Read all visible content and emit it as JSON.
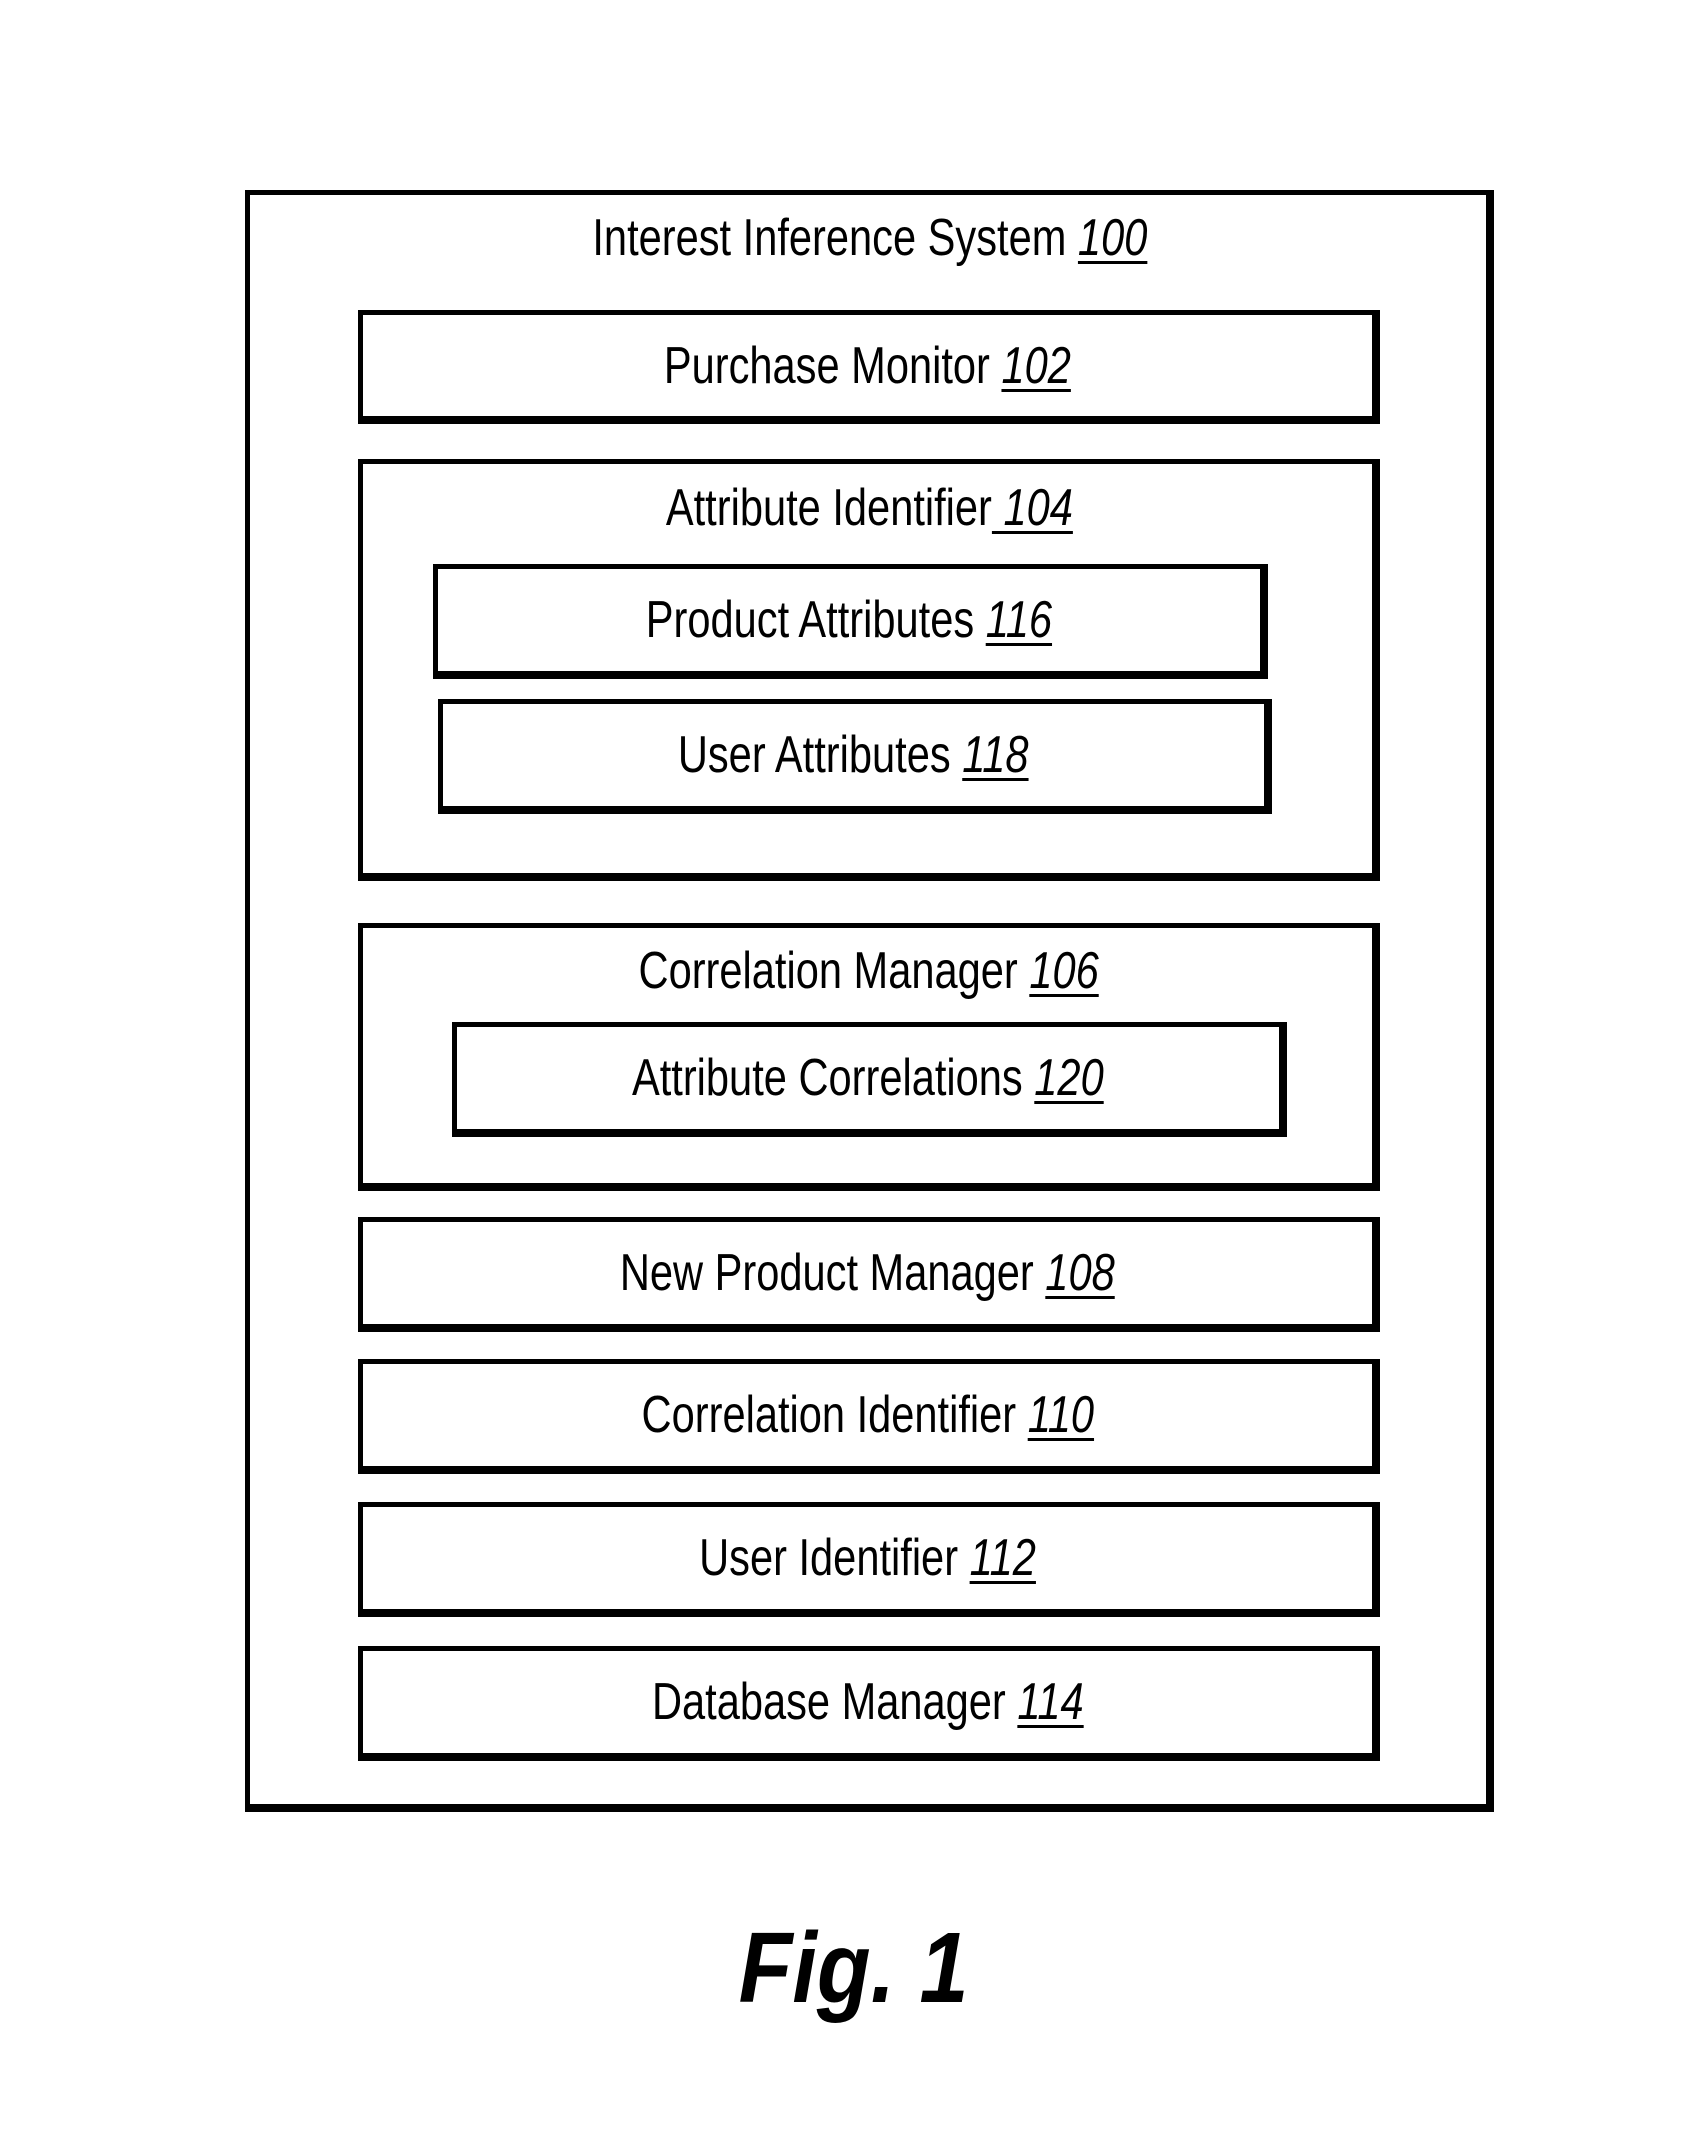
{
  "diagram": {
    "system": {
      "label": "Interest Inference System",
      "ref": "100"
    },
    "components": {
      "purchase_monitor": {
        "label": "Purchase Monitor",
        "ref": "102"
      },
      "attribute_identifier": {
        "label": "Attribute Identifier",
        "ref": " 104",
        "children": {
          "product_attributes": {
            "label": "Product Attributes",
            "ref": "116"
          },
          "user_attributes": {
            "label": "User Attributes",
            "ref": "118"
          }
        }
      },
      "correlation_manager": {
        "label": "Correlation Manager",
        "ref": "106",
        "children": {
          "attribute_correlations": {
            "label": "Attribute Correlations",
            "ref": "120"
          }
        }
      },
      "new_product_manager": {
        "label": "New Product Manager",
        "ref": "108"
      },
      "correlation_identifier": {
        "label": "Correlation Identifier",
        "ref": "110"
      },
      "user_identifier": {
        "label": "User Identifier",
        "ref": "112"
      },
      "database_manager": {
        "label": "Database Manager",
        "ref": "114"
      }
    },
    "figure_label": "Fig. 1"
  }
}
